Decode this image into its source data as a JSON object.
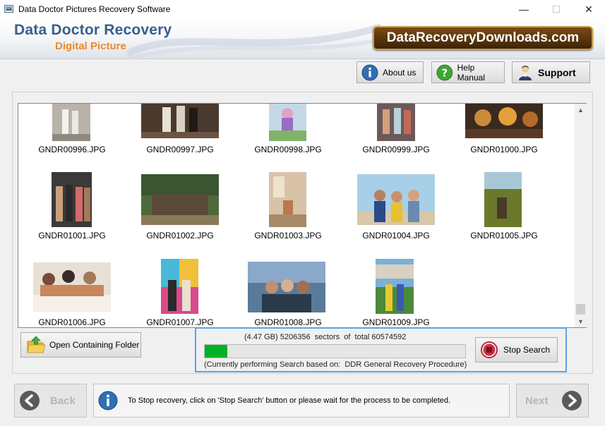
{
  "window": {
    "title": "Data Doctor Pictures Recovery Software",
    "controls": {
      "minimize": "—",
      "maximize": "☐",
      "close": "✕"
    }
  },
  "header": {
    "brand_line1": "Data Doctor Recovery",
    "brand_line2": "Digital Picture",
    "site_badge": "DataRecoveryDownloads.com"
  },
  "toolbar": {
    "about_label": "About us",
    "help_label": "Help Manual",
    "support_label": "Support"
  },
  "gallery": {
    "files": [
      "GNDR00996.JPG",
      "GNDR00997.JPG",
      "GNDR00998.JPG",
      "GNDR00999.JPG",
      "GNDR01000.JPG",
      "GNDR01001.JPG",
      "GNDR01002.JPG",
      "GNDR01003.JPG",
      "GNDR01004.JPG",
      "GNDR01005.JPG",
      "GNDR01006.JPG",
      "GNDR01007.JPG",
      "GNDR01008.JPG",
      "GNDR01009.JPG"
    ]
  },
  "actions": {
    "open_folder_label": "Open Containing Folder",
    "stop_search_label": "Stop Search"
  },
  "progress": {
    "status_text": "(4.47 GB) 5206356  sectors  of  total 60574592",
    "procedure_text": "(Currently performing Search based on:  DDR General Recovery Procedure)",
    "fraction": 0.086
  },
  "footer": {
    "back_label": "Back",
    "next_label": "Next",
    "info_message": "To Stop recovery, click on 'Stop Search' button or please wait for the process to be completed."
  },
  "colors": {
    "progress_fill": "#06b025",
    "highlight_border": "#5ba3e6",
    "brand_blue": "#3a5e8c",
    "brand_orange": "#e98a2e"
  }
}
